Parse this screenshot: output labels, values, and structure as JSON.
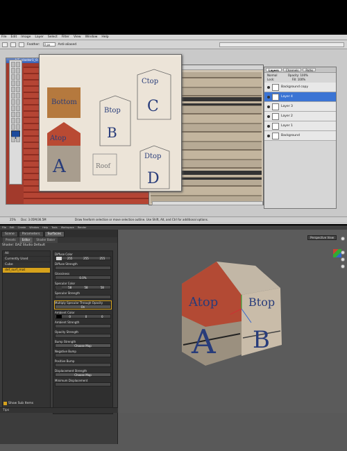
{
  "ps": {
    "menu": [
      "File",
      "Edit",
      "Image",
      "Layer",
      "Select",
      "Filter",
      "View",
      "Window",
      "Help"
    ],
    "options": {
      "feather_label": "Feather:",
      "feather_value": "0 px",
      "antialiased_label": "Anti-aliased"
    },
    "doc_title": "AIT_plaster1_0...",
    "layers_panel": {
      "tabs": [
        "Layers",
        "Channels",
        "Paths"
      ],
      "blend_mode": "Normal",
      "opacity_label": "Opacity:",
      "opacity_value": "100%",
      "lock_label": "Lock:",
      "fill_label": "Fill:",
      "fill_value": "100%",
      "items": [
        {
          "name": "Background copy",
          "selected": false
        },
        {
          "name": "Layer 4",
          "selected": true
        },
        {
          "name": "Layer 3",
          "selected": false
        },
        {
          "name": "Layer 2",
          "selected": false
        },
        {
          "name": "Layer 1",
          "selected": false
        },
        {
          "name": "Background",
          "selected": false
        }
      ]
    },
    "status": {
      "zoom": "25%",
      "doc": "Doc: 3.05M/36.5M",
      "hint": "Draw freeform selection or move selection outline. Use Shift, Alt, and Ctrl for additional options."
    },
    "canvas_letters": {
      "bottom": "Bottom",
      "atop": "Atop",
      "a": "A",
      "btop": "Btop",
      "b": "B",
      "ctop": "Ctop",
      "c": "C",
      "roof": "Roof",
      "dtop": "Dtop",
      "d": "D"
    }
  },
  "daz": {
    "menu": [
      "File",
      "Edit",
      "Create",
      "Window",
      "Help",
      "Tools",
      "Workspace",
      "Render"
    ],
    "tabs": [
      "Scene",
      "Parameters",
      "Surfaces"
    ],
    "active_tab": "Surfaces",
    "subtabs": [
      "Presets",
      "Editor",
      "Shader Baker"
    ],
    "active_subtab": "Editor",
    "shader": "Shader: DAZ Studio Default",
    "tree": [
      "All",
      "Currently Used",
      "Cube",
      "def_surf_mat"
    ],
    "props": [
      {
        "label": "Diffuse Color",
        "v": [
          "255",
          "255",
          "255"
        ]
      },
      {
        "label": "Diffuse Strength",
        "v": [
          ""
        ]
      },
      {
        "label": "Glossiness",
        "v": [
          "0.0%"
        ]
      },
      {
        "label": "Specular Color",
        "v": [
          "58",
          "58",
          "58"
        ]
      },
      {
        "label": "Specular Strength",
        "v": [
          ""
        ]
      },
      {
        "label": "Multiply Specular Through Opacity",
        "v": [
          "On"
        ]
      },
      {
        "label": "Ambient Color",
        "v": [
          "0",
          "0",
          "0"
        ]
      },
      {
        "label": "Ambient Strength",
        "v": [
          ""
        ]
      },
      {
        "label": "Opacity Strength",
        "v": [
          ""
        ]
      },
      {
        "label": "Bump Strength",
        "v": [
          "Choose Map"
        ]
      },
      {
        "label": "Negative Bump",
        "v": [
          ""
        ]
      },
      {
        "label": "Positive Bump",
        "v": [
          ""
        ]
      },
      {
        "label": "Displacement Strength",
        "v": [
          "Choose Map"
        ]
      },
      {
        "label": "Minimum Displacement",
        "v": [
          ""
        ]
      }
    ],
    "show_sub": "Show Sub Items",
    "tips": "Tips",
    "viewport": "Perspective View",
    "cube_letters": {
      "atop": "Atop",
      "btop": "Btop",
      "a": "A",
      "b": "B"
    }
  },
  "colors": {
    "accent": "#d6a21c",
    "selection": "#3b74d4",
    "foreground": "#1c4a9c",
    "brick": "#a23a2c"
  }
}
